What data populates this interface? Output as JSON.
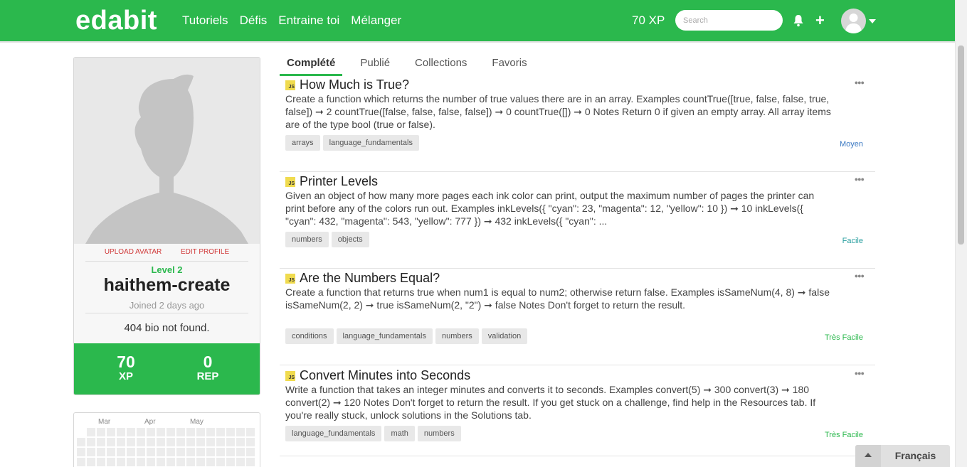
{
  "header": {
    "logo": "edabit",
    "nav": [
      "Tutoriels",
      "Défis",
      "Entraine toi",
      "Mélanger"
    ],
    "xp": "70 XP",
    "search_placeholder": "Search"
  },
  "profile": {
    "upload_avatar": "UPLOAD AVATAR",
    "edit_profile": "EDIT PROFILE",
    "level": "Level 2",
    "username": "haithem-create",
    "joined": "Joined 2 days ago",
    "bio": "404 bio not found.",
    "xp_value": "70",
    "xp_label": "XP",
    "rep_value": "0",
    "rep_label": "REP"
  },
  "calendar": {
    "months": [
      "Mar",
      "Apr",
      "May"
    ]
  },
  "tabs": [
    "Complété",
    "Publié",
    "Collections",
    "Favoris"
  ],
  "challenges": [
    {
      "badge": "JS",
      "title": "How Much is True?",
      "description": "Create a function which returns the number of true values there are in an array. Examples countTrue([true, false, false, true, false]) ➞ 2 countTrue([false, false, false, false]) ➞ 0 countTrue([]) ➞ 0 Notes Return 0 if given an empty array. All array items are of the type bool (true or false).",
      "tags": [
        "arrays",
        "language_fundamentals"
      ],
      "difficulty": "Moyen",
      "difficulty_color": "#3a78c2"
    },
    {
      "badge": "JS",
      "title": "Printer Levels",
      "description": "Given an object of how many more pages each ink color can print, output the maximum number of pages the printer can print before any of the colors run out. Examples inkLevels({ \"cyan\": 23, \"magenta\": 12, \"yellow\": 10 }) ➞ 10 inkLevels({ \"cyan\": 432, \"magenta\": 543, \"yellow\": 777 }) ➞ 432 inkLevels({ \"cyan\": ...",
      "tags": [
        "numbers",
        "objects"
      ],
      "difficulty": "Facile",
      "difficulty_color": "#2a9fa0"
    },
    {
      "badge": "JS",
      "title": "Are the Numbers Equal?",
      "description": "Create a function that returns true when num1 is equal to num2; otherwise return false. Examples isSameNum(4, 8) ➞ false isSameNum(2, 2) ➞ true isSameNum(2, \"2\") ➞ false Notes Don't forget to return the result.",
      "tags": [
        "conditions",
        "language_fundamentals",
        "numbers",
        "validation"
      ],
      "difficulty": "Très Facile",
      "difficulty_color": "#2bb84d"
    },
    {
      "badge": "JS",
      "title": "Convert Minutes into Seconds",
      "description": "Write a function that takes an integer minutes and converts it to seconds. Examples convert(5) ➞ 300 convert(3) ➞ 180 convert(2) ➞ 120 Notes Don't forget to return the result. If you get stuck on a challenge, find help in the Resources tab. If you're really stuck, unlock solutions in the Solutions tab.",
      "tags": [
        "language_fundamentals",
        "math",
        "numbers"
      ],
      "difficulty": "Très Facile",
      "difficulty_color": "#2bb84d"
    }
  ],
  "language": "Français",
  "colors": {
    "brand": "#2bb84d"
  },
  "icons": {
    "bell": "bell-icon",
    "plus": "plus-icon",
    "more": "more-dots-icon"
  }
}
